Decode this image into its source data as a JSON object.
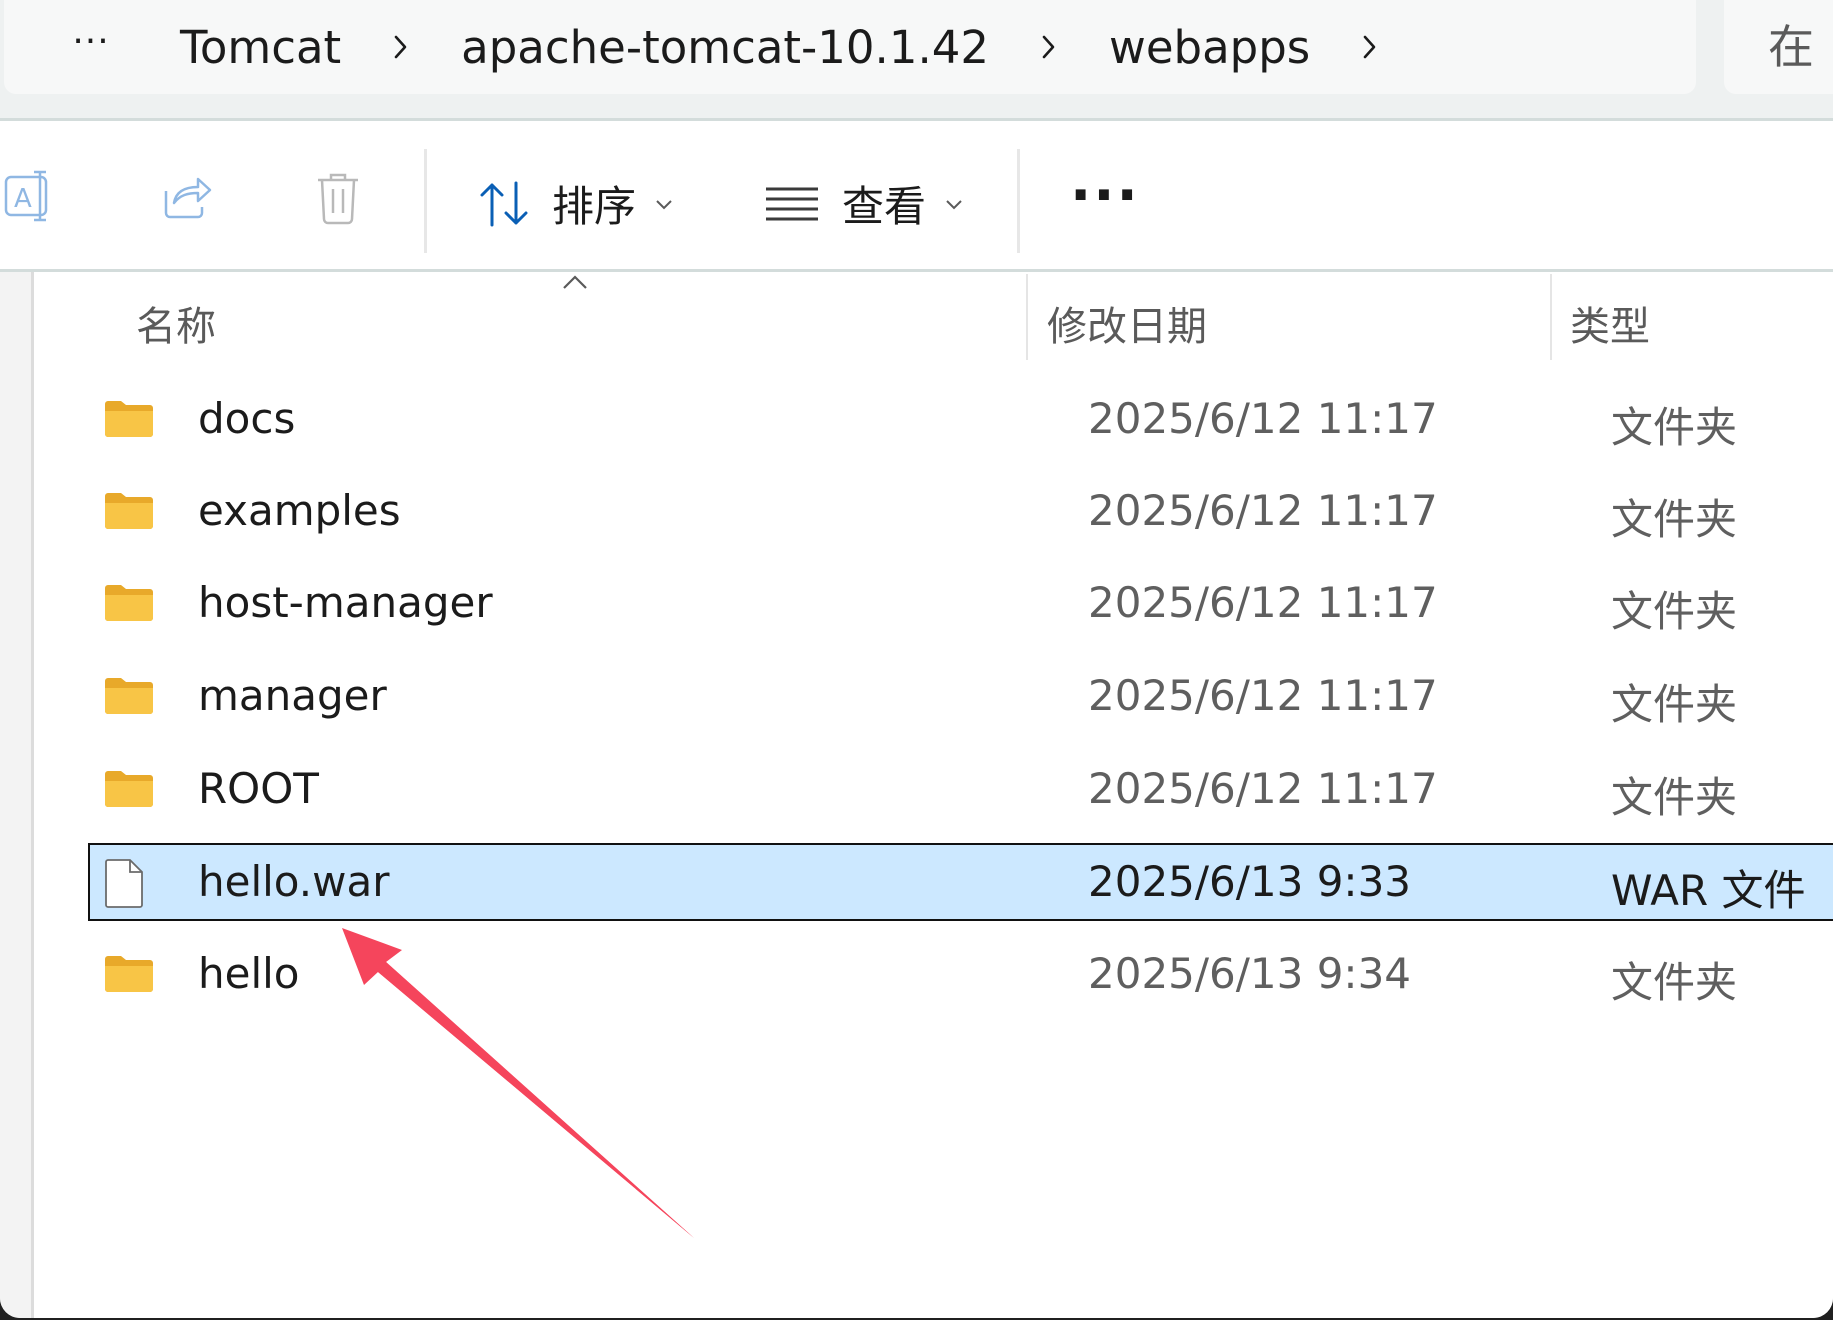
{
  "breadcrumb": {
    "more_label": "···",
    "items": [
      {
        "label": "Tomcat"
      },
      {
        "label": "apache-tomcat-10.1.42"
      },
      {
        "label": "webapps"
      }
    ],
    "search_partial": "在 "
  },
  "toolbar": {
    "rename_icon": "rename-icon",
    "share_icon": "share-icon",
    "delete_icon": "delete-icon",
    "sort_label": "排序",
    "view_label": "查看",
    "more_label": "···"
  },
  "columns": {
    "name": "名称",
    "date": "修改日期",
    "type": "类型"
  },
  "files": [
    {
      "name": "docs",
      "date": "2025/6/12 11:17",
      "type": "文件夹",
      "icon": "folder-icon",
      "selected": false
    },
    {
      "name": "examples",
      "date": "2025/6/12 11:17",
      "type": "文件夹",
      "icon": "folder-icon",
      "selected": false
    },
    {
      "name": "host-manager",
      "date": "2025/6/12 11:17",
      "type": "文件夹",
      "icon": "folder-icon",
      "selected": false
    },
    {
      "name": "manager",
      "date": "2025/6/12 11:17",
      "type": "文件夹",
      "icon": "folder-icon",
      "selected": false
    },
    {
      "name": "ROOT",
      "date": "2025/6/12 11:17",
      "type": "文件夹",
      "icon": "folder-icon",
      "selected": false
    },
    {
      "name": "hello.war",
      "date": "2025/6/13 9:33",
      "type": "WAR 文件",
      "icon": "file-icon",
      "selected": true
    },
    {
      "name": "hello",
      "date": "2025/6/13 9:34",
      "type": "文件夹",
      "icon": "folder-icon",
      "selected": false
    }
  ],
  "colors": {
    "selection": "#cce8ff",
    "folder": "#f8c546",
    "annotation_arrow": "#f5455c",
    "accent": "#0067c0"
  }
}
